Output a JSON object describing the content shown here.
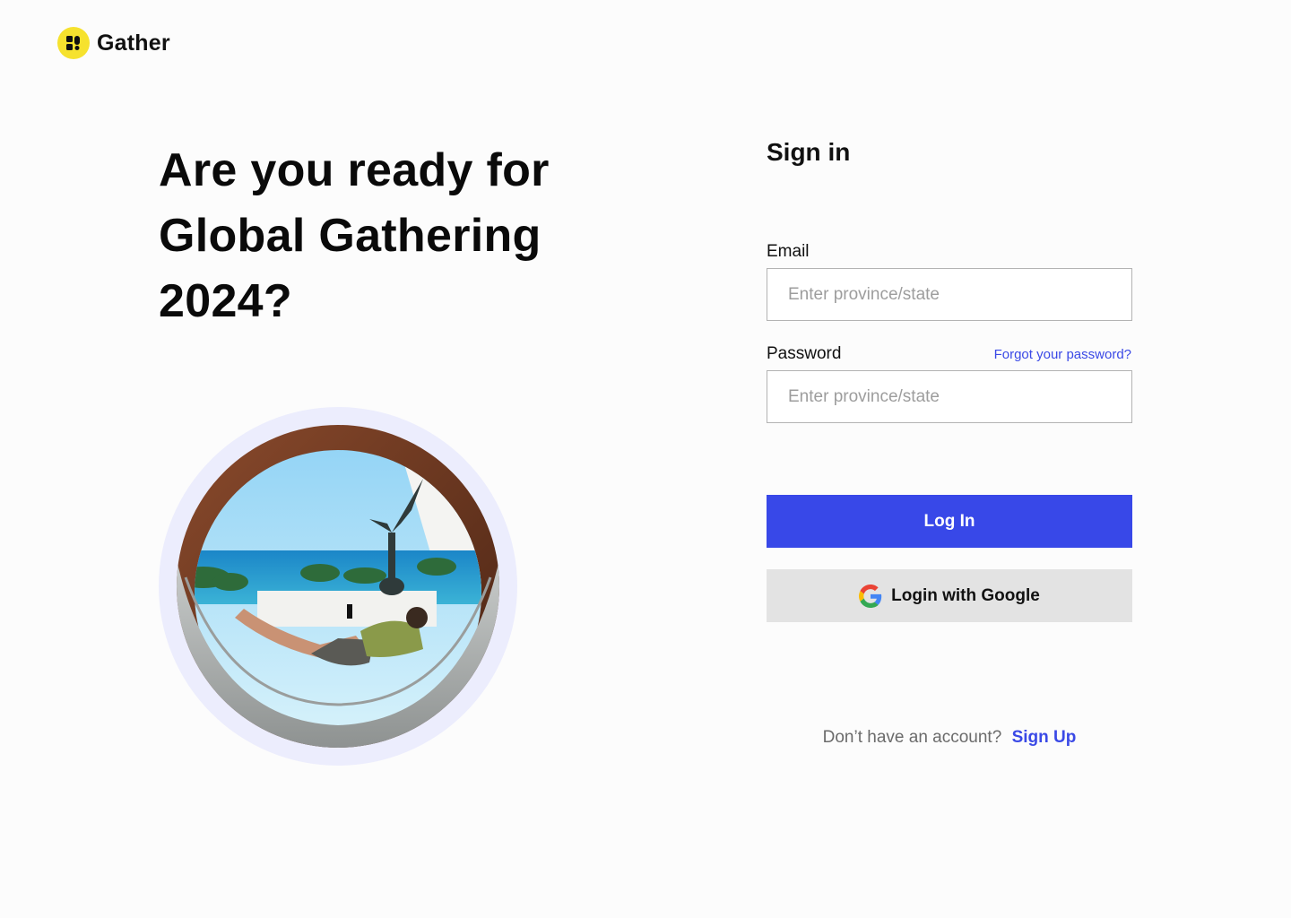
{
  "brand": {
    "name": "Gather",
    "icon": "gather-logo-icon",
    "accent": "#f6e22e"
  },
  "hero": {
    "headline": "Are you ready for Global Gathering 2024?",
    "image_label": "woman-reclining-in-round-window-photo",
    "ring_color": "#ecedfd"
  },
  "signin": {
    "title": "Sign in",
    "email": {
      "label": "Email",
      "placeholder": "Enter province/state",
      "value": ""
    },
    "password": {
      "label": "Password",
      "placeholder": "Enter province/state",
      "value": "",
      "forgot_label": "Forgot your password?"
    },
    "login_button": "Log In",
    "google_button": "Login with Google",
    "google_icon": "google-icon",
    "signup_prompt": "Don’t have an account?",
    "signup_link": "Sign Up",
    "primary_color": "#3848e8",
    "link_color": "#3a49e6"
  }
}
